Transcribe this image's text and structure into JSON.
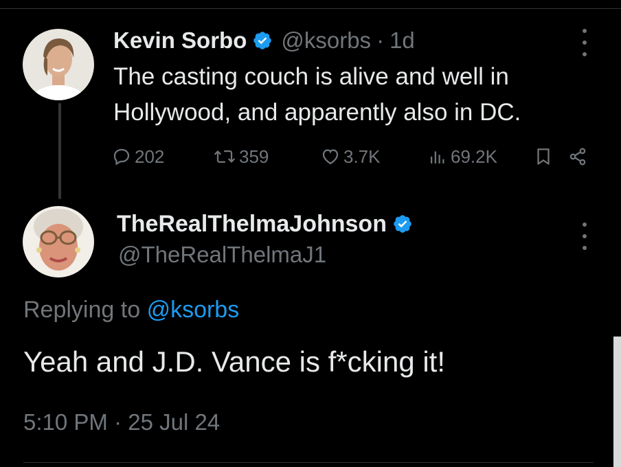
{
  "tweet": {
    "author_name": "Kevin Sorbo",
    "handle": "@ksorbs",
    "separator": "·",
    "time_ago": "1d",
    "text": "The casting couch is alive and well in Hollywood, and apparently also in DC.",
    "stats": {
      "replies": "202",
      "retweets": "359",
      "likes": "3.7K",
      "views": "69.2K"
    }
  },
  "reply": {
    "author_name": "TheRealThelmaJohnson",
    "handle": "@TheRealThelmaJ1",
    "replying_prefix": "Replying to",
    "replying_to": "@ksorbs",
    "text": "Yeah and J.D. Vance is f*cking it!",
    "timestamp": "5:10 PM · 25 Jul 24"
  },
  "colors": {
    "background": "#000000",
    "text": "#e7e9ea",
    "secondary": "#71767b",
    "accent": "#1d9bf0"
  },
  "icons": [
    "verified-badge-icon",
    "more-icon",
    "reply-icon",
    "retweet-icon",
    "like-icon",
    "views-icon",
    "bookmark-icon",
    "share-icon"
  ]
}
